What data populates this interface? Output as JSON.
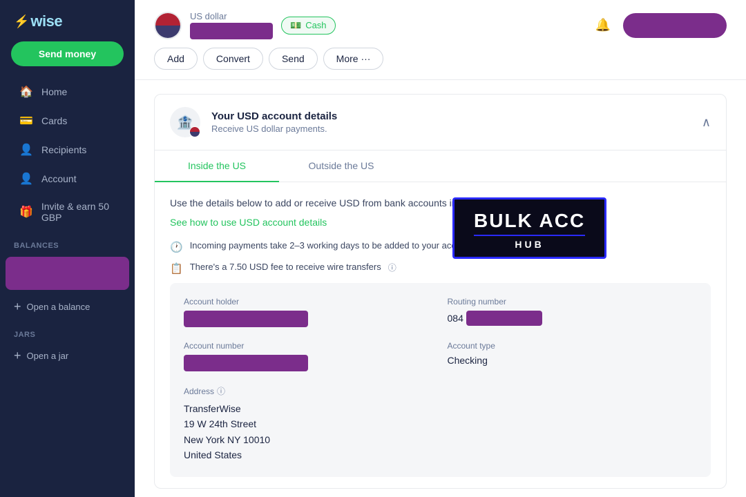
{
  "brand": {
    "logo": "⚡wise",
    "send_money_label": "Send money"
  },
  "sidebar": {
    "nav_items": [
      {
        "id": "home",
        "label": "Home",
        "icon": "🏠"
      },
      {
        "id": "cards",
        "label": "Cards",
        "icon": "💳"
      },
      {
        "id": "recipients",
        "label": "Recipients",
        "icon": "👤"
      },
      {
        "id": "account",
        "label": "Account",
        "icon": "👤"
      },
      {
        "id": "invite",
        "label": "Invite & earn 50 GBP",
        "icon": "🎁"
      }
    ],
    "balances_label": "Balances",
    "open_balance_label": "Open a balance",
    "jars_label": "Jars",
    "open_jar_label": "Open a jar"
  },
  "topbar": {
    "currency_name": "US dollar",
    "cash_label": "Cash",
    "actions": [
      "Add",
      "Convert",
      "Send",
      "More ..."
    ],
    "bell_icon": "🔔"
  },
  "panel": {
    "title": "Your USD account details",
    "subtitle": "Receive US dollar payments.",
    "tabs": [
      "Inside the US",
      "Outside the US"
    ],
    "active_tab": 0,
    "info_text": "Use the details below to add or receive USD from bank accounts inside the US.",
    "see_how_link": "See how to use USD account details",
    "notices": [
      "Incoming payments take 2–3 working days to be added to your account",
      "There's a 7.50 USD fee to receive wire transfers"
    ],
    "fields": {
      "account_holder_label": "Account holder",
      "routing_number_label": "Routing number",
      "routing_prefix": "084",
      "account_number_label": "Account number",
      "account_type_label": "Account type",
      "account_type_value": "Checking",
      "address_label": "Address",
      "address_lines": [
        "TransferWise",
        "19 W 24th Street",
        "New York NY 10010",
        "United States"
      ]
    }
  },
  "bulk_acc": {
    "title": "BULK ACC",
    "subtitle": "HUB"
  }
}
